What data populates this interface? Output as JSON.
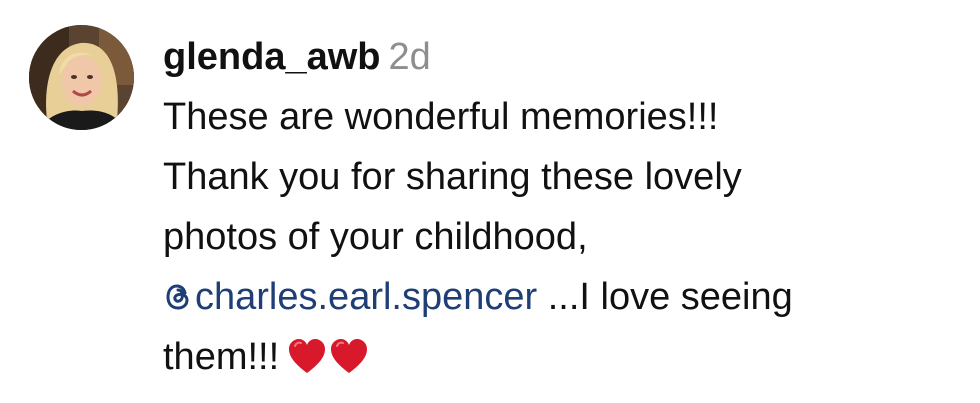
{
  "comment": {
    "username": "glenda_awb",
    "timestamp": "2d",
    "lines": [
      "These are wonderful memories!!!",
      "Thank you for sharing these lovely",
      "photos of your childhood,"
    ],
    "mention": "charles.earl.spencer",
    "mention_icon": "threads-icon",
    "after_mention": " ...I love seeing",
    "last_line": "them!!!",
    "emoji": [
      "heart-icon",
      "heart-icon"
    ]
  },
  "colors": {
    "mention": "#1f3e75",
    "timestamp": "#8e8e8e",
    "heart": "#d7192b"
  }
}
